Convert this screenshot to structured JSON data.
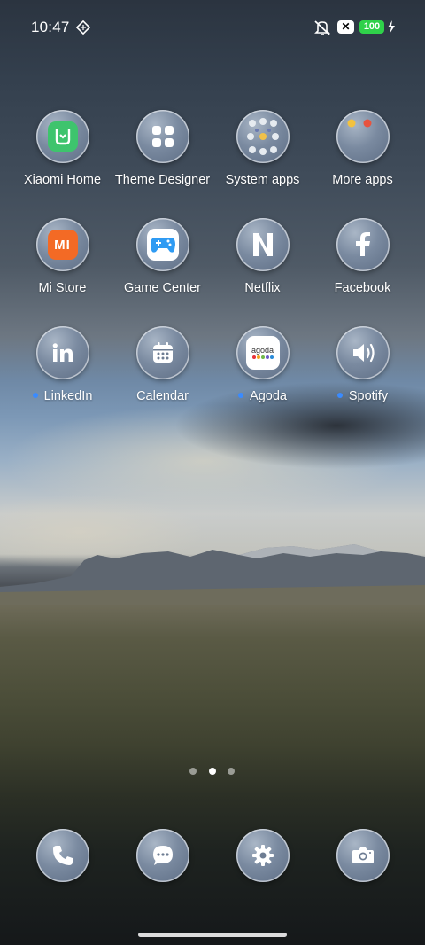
{
  "status_bar": {
    "time": "10:47",
    "battery_level": "100",
    "notification_badge": "✕",
    "icons": [
      "diamond-icon",
      "mute-vibrate-icon",
      "charging-bolt-icon"
    ]
  },
  "apps": [
    {
      "label": "Xiaomi Home",
      "icon": "xiaomi-home-icon",
      "notify": false
    },
    {
      "label": "Theme Designer",
      "icon": "theme-designer-icon",
      "notify": false
    },
    {
      "label": "System apps",
      "icon": "folder-icon",
      "notify": false
    },
    {
      "label": "More apps",
      "icon": "folder-icon",
      "notify": false
    },
    {
      "label": "Mi Store",
      "icon": "mi-store-icon",
      "notify": false
    },
    {
      "label": "Game Center",
      "icon": "gamepad-icon",
      "notify": false
    },
    {
      "label": "Netflix",
      "icon": "netflix-icon",
      "notify": false
    },
    {
      "label": "Facebook",
      "icon": "facebook-icon",
      "notify": false
    },
    {
      "label": "LinkedIn",
      "icon": "linkedin-icon",
      "notify": true
    },
    {
      "label": "Calendar",
      "icon": "calendar-icon",
      "notify": false
    },
    {
      "label": "Agoda",
      "icon": "agoda-icon",
      "notify": true
    },
    {
      "label": "Spotify",
      "icon": "spotify-icon",
      "notify": true
    }
  ],
  "agoda_logo_text": "agoda",
  "mi_logo_text": "mi",
  "page_indicator": {
    "count": 3,
    "active": 2
  },
  "dock": [
    {
      "icon": "phone-icon"
    },
    {
      "icon": "messages-icon"
    },
    {
      "icon": "settings-gear-icon"
    },
    {
      "icon": "camera-icon"
    }
  ],
  "colors": {
    "battery": "#2fd14a",
    "notification_dot": "#3a8bff",
    "xiaomi_home_green": "#3ec46d",
    "mi_store_orange": "#f36a25"
  }
}
